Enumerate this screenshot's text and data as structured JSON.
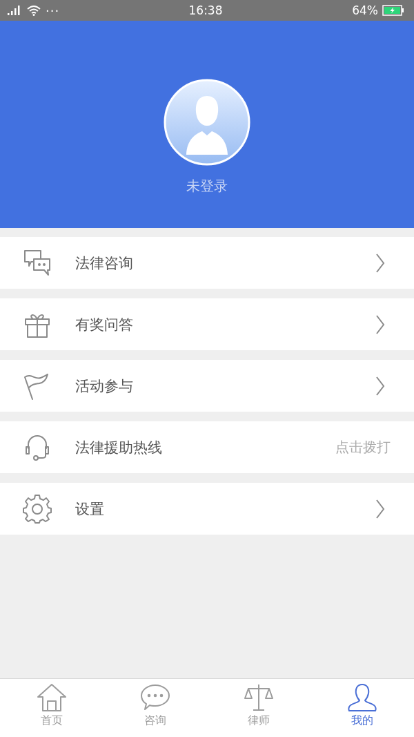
{
  "status_bar": {
    "dots": "···",
    "time": "16:38",
    "battery_percent": "64%"
  },
  "profile": {
    "login_status": "未登录"
  },
  "menu": [
    {
      "kind": "link",
      "label": "法律咨询"
    },
    {
      "kind": "link",
      "label": "有奖问答"
    },
    {
      "kind": "link",
      "label": "活动参与"
    },
    {
      "kind": "action",
      "label": "法律援助热线",
      "action": "点击拨打"
    },
    {
      "kind": "link",
      "label": "设置"
    }
  ],
  "tab_bar": [
    {
      "label": "首页",
      "selected": false
    },
    {
      "label": "咨询",
      "selected": false
    },
    {
      "label": "律师",
      "selected": false
    },
    {
      "label": "我的",
      "selected": true
    }
  ]
}
